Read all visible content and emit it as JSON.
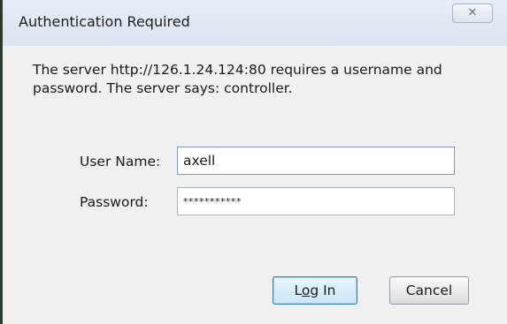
{
  "dialog": {
    "title": "Authentication Required",
    "close_icon": "close-icon",
    "message": "The server http://126.1.24.124:80 requires a username and password. The server says: controller."
  },
  "form": {
    "username_label": "User Name:",
    "username_value": "axell",
    "password_label": "Password:",
    "password_value": "***********"
  },
  "buttons": {
    "login_label_prefix": "L",
    "login_label_mnemonic": "o",
    "login_label_suffix": "g In",
    "cancel_label": "Cancel"
  },
  "colors": {
    "titlebar": "#dbe4f0",
    "dialog_bg": "#f0f0f0",
    "default_button_border": "#3c7fb1"
  }
}
